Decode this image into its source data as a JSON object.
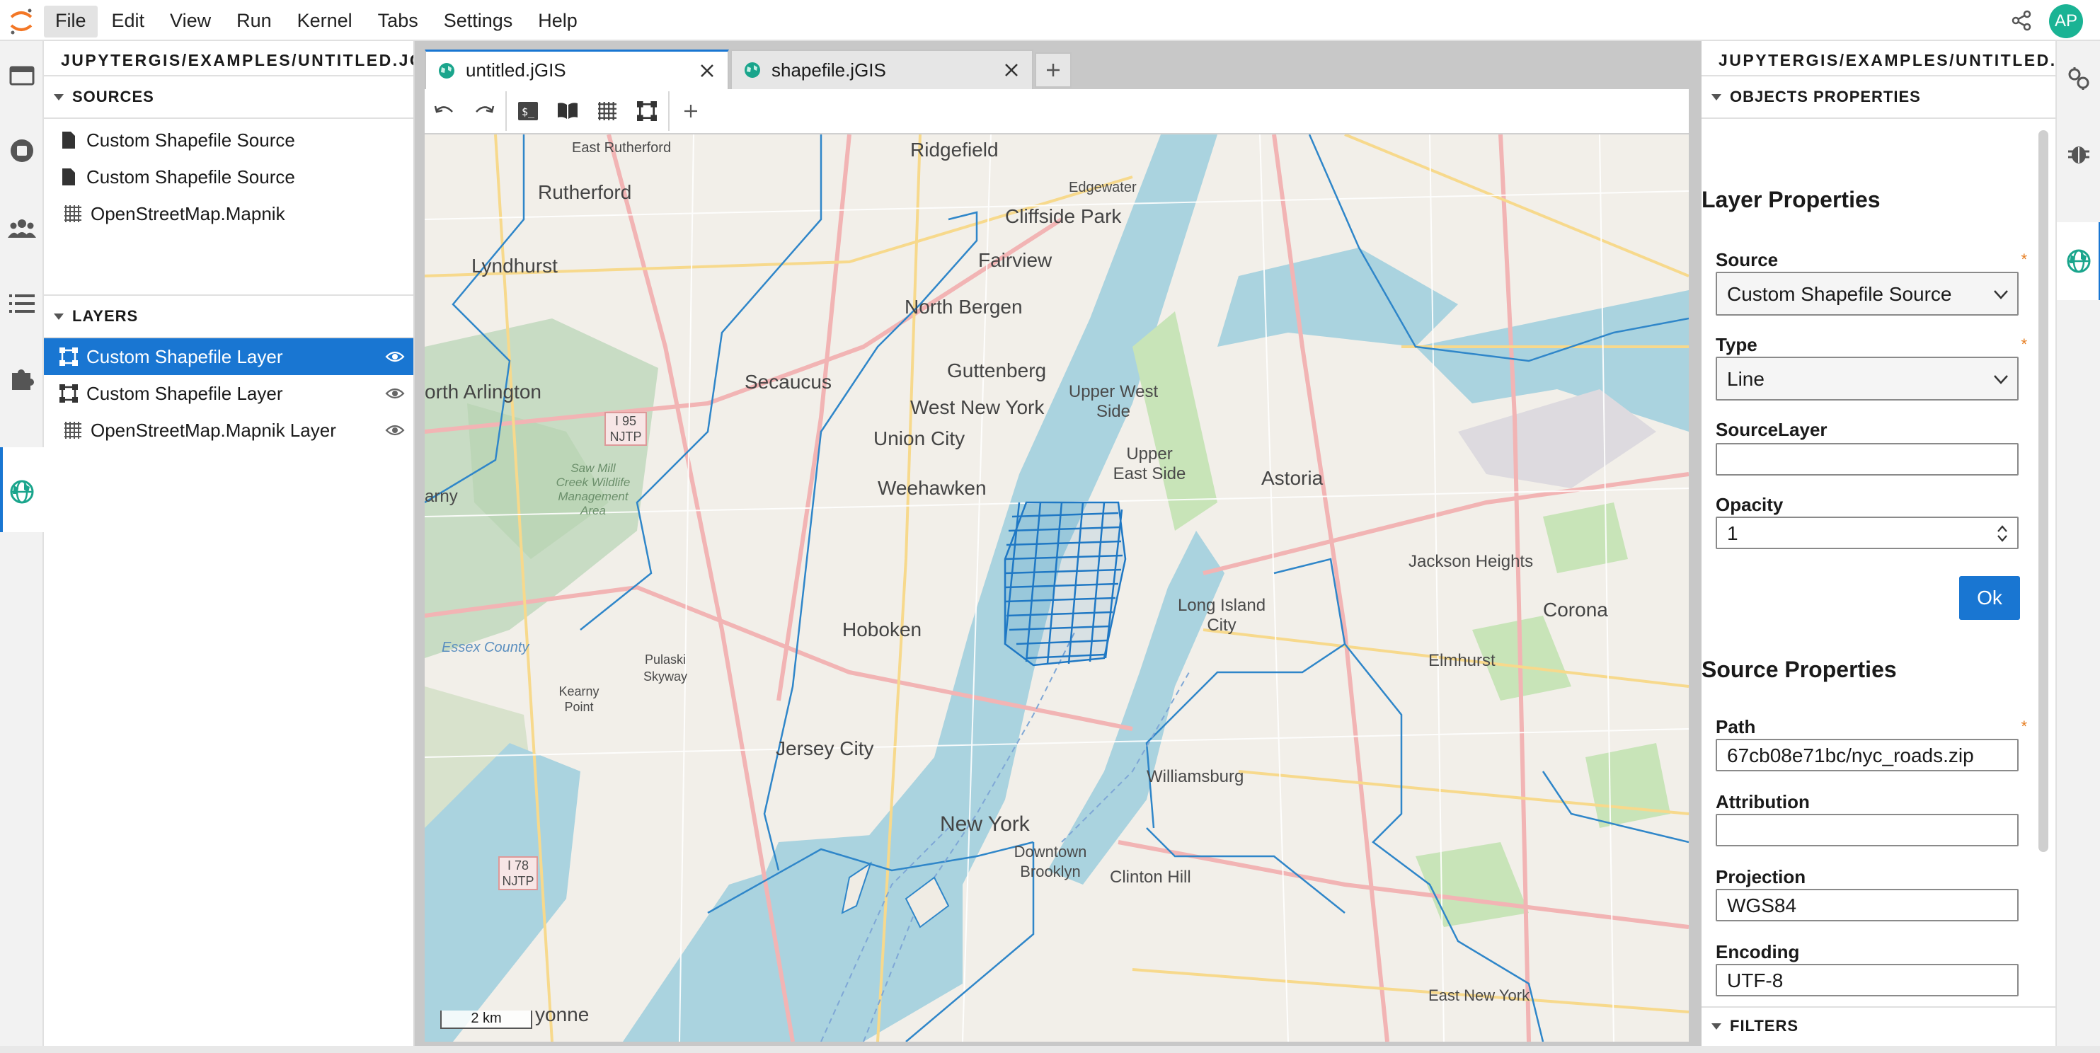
{
  "menubar": {
    "items": [
      "File",
      "Edit",
      "View",
      "Run",
      "Kernel",
      "Tabs",
      "Settings",
      "Help"
    ],
    "active": "File",
    "avatar_initials": "AP",
    "avatar_color": "#1ab394"
  },
  "left_activity": {
    "icons": [
      "folder-icon",
      "running-icon",
      "collaborators-icon",
      "toc-icon",
      "extensions-icon",
      "jgis-icon"
    ]
  },
  "left_panel": {
    "path": "JUPYTERGIS/EXAMPLES/UNTITLED.JGIS",
    "sources": {
      "header": "SOURCES",
      "items": [
        {
          "label": "Custom Shapefile Source",
          "icon": "file-icon"
        },
        {
          "label": "Custom Shapefile Source",
          "icon": "file-icon"
        },
        {
          "label": "OpenStreetMap.Mapnik",
          "icon": "raster-icon"
        }
      ]
    },
    "layers": {
      "header": "LAYERS",
      "items": [
        {
          "label": "Custom Shapefile Layer",
          "icon": "vector-icon",
          "selected": true
        },
        {
          "label": "Custom Shapefile Layer",
          "icon": "vector-icon",
          "selected": false
        },
        {
          "label": "OpenStreetMap.Mapnik Layer",
          "icon": "raster-icon",
          "selected": false
        }
      ]
    }
  },
  "tabs": [
    {
      "label": "untitled.jGIS",
      "active": true
    },
    {
      "label": "shapefile.jGIS",
      "active": false
    }
  ],
  "toolbar": {
    "buttons": [
      "undo-icon",
      "redo-icon",
      "terminal-icon",
      "book-icon",
      "raster-layer-icon",
      "vector-layer-icon",
      "add-icon"
    ]
  },
  "map": {
    "labels": {
      "east_rutherford": "East Rutherford",
      "ridgefield": "Ridgefield",
      "rutherford": "Rutherford",
      "edgewater": "Edgewater",
      "cliffside_park": "Cliffside Park",
      "lyndhurst": "Lyndhurst",
      "fairview": "Fairview",
      "north_bergen": "North Bergen",
      "secaucus": "Secaucus",
      "guttenberg": "Guttenberg",
      "upper_west_side": "Upper West Side",
      "north_arlington": "orth Arlington",
      "west_new_york": "West New York",
      "union_city": "Union City",
      "upper_east_side": "Upper East Side",
      "astoria": "Astoria",
      "weehawken": "Weehawken",
      "jackson_heights": "Jackson Heights",
      "long_island_city": "Long Island City",
      "hoboken": "Hoboken",
      "corona": "Corona",
      "pulaski": "Pulaski Skyway",
      "elmhurst": "Elmhurst",
      "kearny": "Kearny Point",
      "jersey_city": "Jersey City",
      "new_york": "New York",
      "williamsburg": "Williamsburg",
      "downtown_brooklyn": "Downtown Brooklyn",
      "clinton_hill": "Clinton Hill",
      "east_new_york": "East New York",
      "bayonne": "yonne",
      "njtp1": "I 95 NJTP",
      "njtp2": "I 78 NJTP",
      "arny": "arny",
      "sawmill": "Saw Mill Creek Wildlife Management Area",
      "essex": "Essex County"
    },
    "scale": "2 km",
    "layer_color": "#1f78c4"
  },
  "right_panel": {
    "path": "JUPYTERGIS/EXAMPLES/UNTITLED.JGIS",
    "objects_header": "OBJECTS PROPERTIES",
    "layer_properties_title": "Layer Properties",
    "source_label": "Source",
    "source_value": "Custom Shapefile Source",
    "type_label": "Type",
    "type_value": "Line",
    "sourcelayer_label": "SourceLayer",
    "sourcelayer_value": "",
    "opacity_label": "Opacity",
    "opacity_value": "1",
    "ok_label": "Ok",
    "source_properties_title": "Source Properties",
    "path_label": "Path",
    "path_value": "67cb08e71bc/nyc_roads.zip",
    "attribution_label": "Attribution",
    "attribution_value": "",
    "projection_label": "Projection",
    "projection_value": "WGS84",
    "encoding_label": "Encoding",
    "encoding_value": "UTF-8",
    "filters_header": "FILTERS",
    "required_mark": "*"
  },
  "right_activity": {
    "icons": [
      "property-inspector-icon",
      "debugger-icon",
      "jgis-properties-icon"
    ]
  }
}
